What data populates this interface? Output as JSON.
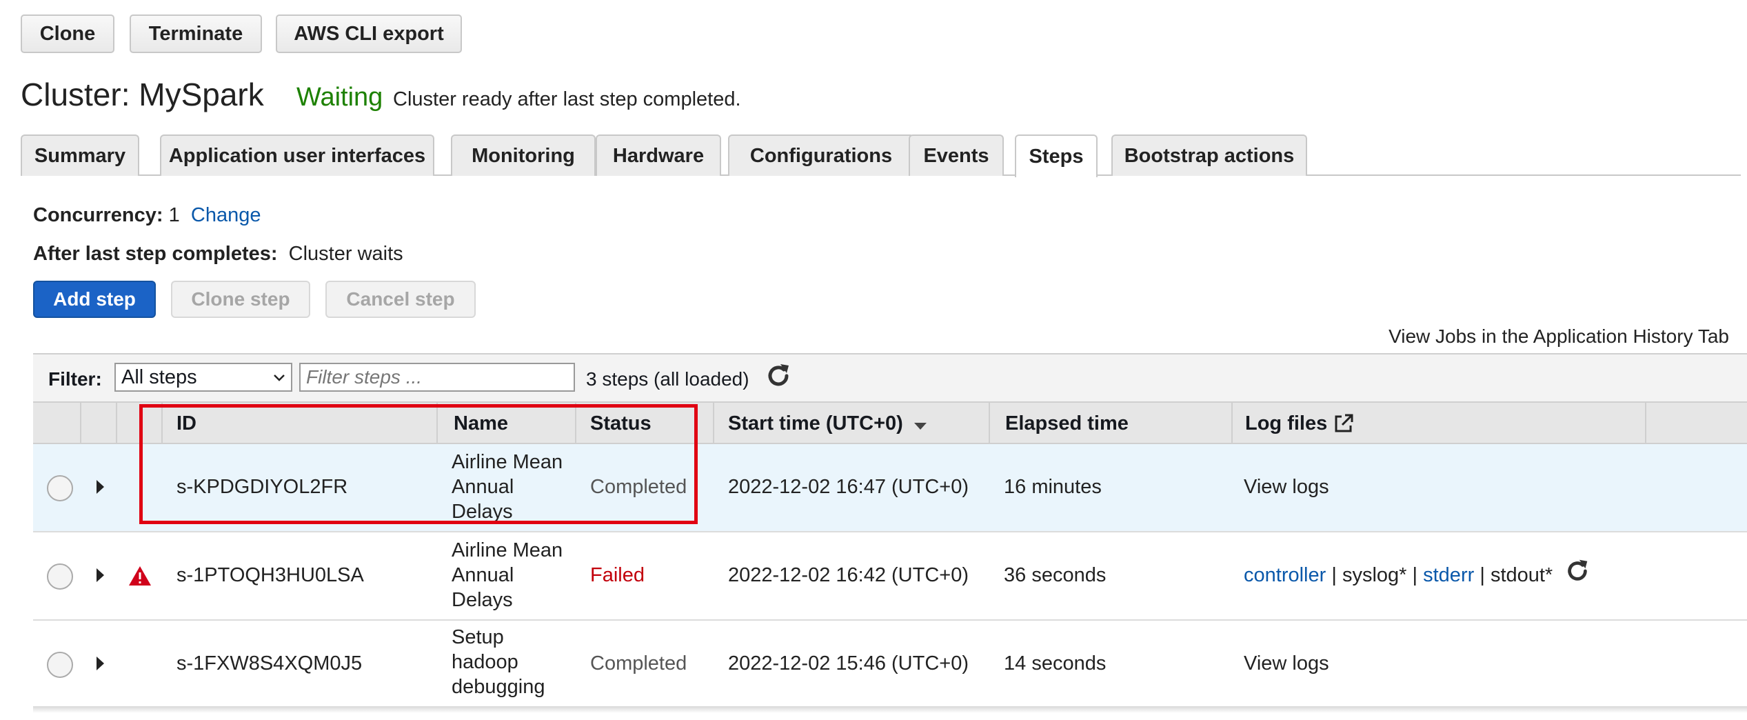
{
  "toolbar": {
    "clone_label": "Clone",
    "terminate_label": "Terminate",
    "export_label": "AWS CLI export"
  },
  "cluster": {
    "title": "Cluster: MySpark",
    "status": "Waiting",
    "status_message": "Cluster ready after last step completed."
  },
  "tabs": [
    {
      "label": "Summary"
    },
    {
      "label": "Application user interfaces"
    },
    {
      "label": "Monitoring"
    },
    {
      "label": "Hardware"
    },
    {
      "label": "Configurations"
    },
    {
      "label": "Events"
    },
    {
      "label": "Steps"
    },
    {
      "label": "Bootstrap actions"
    }
  ],
  "steps_panel": {
    "concurrency_label": "Concurrency:",
    "concurrency_value": "1",
    "change_link": "Change",
    "after_label": "After last step completes:",
    "after_value": "Cluster waits",
    "add_step_label": "Add step",
    "clone_step_label": "Clone step",
    "cancel_step_label": "Cancel step",
    "history_link": "View Jobs in the Application History Tab"
  },
  "filter": {
    "label": "Filter:",
    "selected": "All steps",
    "placeholder": "Filter steps ...",
    "count": "3 steps (all loaded)"
  },
  "table": {
    "columns": [
      "ID",
      "Name",
      "Status",
      "Start time (UTC+0)",
      "Elapsed time",
      "Log files"
    ],
    "rows": [
      {
        "id": "s-KPDGDIYOL2FR",
        "name": [
          "Airline Mean",
          "Annual",
          "Delays"
        ],
        "status": "Completed",
        "start": "2022-12-02 16:47 (UTC+0)",
        "elapsed": "16 minutes",
        "log": "View logs"
      },
      {
        "id": "s-1PTOQH3HU0LSA",
        "name": [
          "Airline Mean",
          "Annual",
          "Delays"
        ],
        "status": "Failed",
        "start": "2022-12-02 16:42 (UTC+0)",
        "elapsed": "36 seconds",
        "logs": {
          "controller": "controller",
          "syslog": "syslog*",
          "stderr": "stderr",
          "stdout": "stdout*",
          "sep": "|"
        }
      },
      {
        "id": "s-1FXW8S4XQM0J5",
        "name": [
          "Setup",
          "hadoop",
          "debugging"
        ],
        "status": "Completed",
        "start": "2022-12-02 15:46 (UTC+0)",
        "elapsed": "14 seconds",
        "log": "View logs"
      }
    ]
  },
  "colors": {
    "waiting": "#1d8102",
    "failed": "#c2000b",
    "link": "#0a58aa",
    "primary": "#1b63c6",
    "highlight": "#e00012"
  }
}
